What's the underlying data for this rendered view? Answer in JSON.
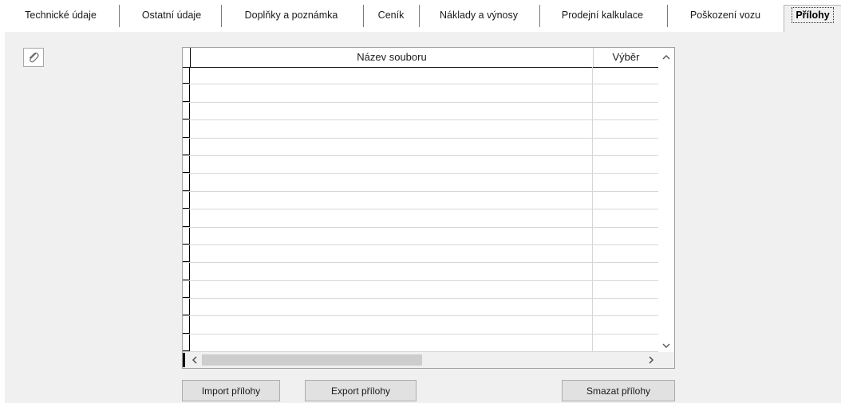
{
  "tabs": [
    {
      "label": "Technické údaje"
    },
    {
      "label": "Ostatní údaje"
    },
    {
      "label": "Doplňky a poznámka"
    },
    {
      "label": "Ceník"
    },
    {
      "label": "Náklady a výnosy"
    },
    {
      "label": "Prodejní kalkulace"
    },
    {
      "label": "Poškození vozu"
    },
    {
      "label": "Přílohy",
      "active": true
    }
  ],
  "grid": {
    "columns": [
      "Název souboru",
      "Výběr"
    ],
    "rows": [
      {
        "name": "",
        "selected": ""
      },
      {
        "name": "",
        "selected": ""
      },
      {
        "name": "",
        "selected": ""
      },
      {
        "name": "",
        "selected": ""
      },
      {
        "name": "",
        "selected": ""
      },
      {
        "name": "",
        "selected": ""
      },
      {
        "name": "",
        "selected": ""
      },
      {
        "name": "",
        "selected": ""
      },
      {
        "name": "",
        "selected": ""
      },
      {
        "name": "",
        "selected": ""
      },
      {
        "name": "",
        "selected": ""
      },
      {
        "name": "",
        "selected": ""
      },
      {
        "name": "",
        "selected": ""
      },
      {
        "name": "",
        "selected": ""
      },
      {
        "name": "",
        "selected": ""
      },
      {
        "name": "",
        "selected": ""
      }
    ]
  },
  "icons": {
    "attach": "paperclip-icon",
    "scroll_up": "chevron-up-icon",
    "scroll_down": "chevron-down-icon",
    "scroll_left": "chevron-left-icon",
    "scroll_right": "chevron-right-icon"
  },
  "buttons": {
    "import": "Import přílohy",
    "export": "Export přílohy",
    "delete": "Smazat přílohy"
  }
}
